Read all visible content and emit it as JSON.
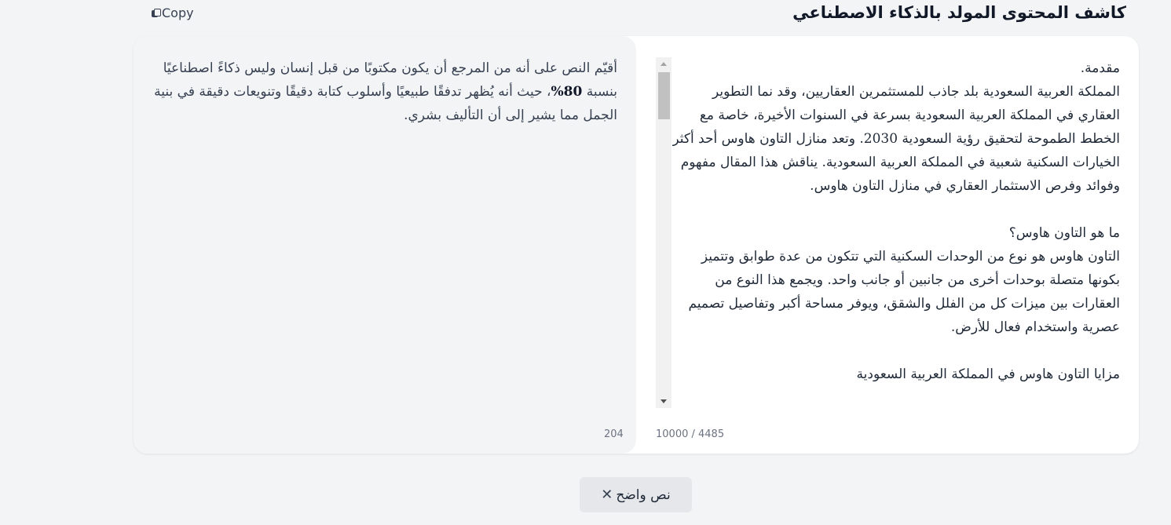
{
  "header": {
    "title": "كاشف المحتوى المولد بالذكاء الاصطناعي",
    "copy_label": "Copy",
    "copy_icon": "copy-icon"
  },
  "result": {
    "text_before": "أقيّم النص على أنه من المرجع أن يكون مكتوبًا من قبل إنسان وليس ذكاءً اصطناعيًا بنسبة ",
    "percentage": "80%",
    "text_after": "، حيث أنه يُظهر تدفقًا طبيعيًا وأسلوب كتابة دقيقًا وتنويعات دقيقة في بنية الجمل مما يشير إلى أن التأليف بشري.",
    "word_count": "204"
  },
  "input": {
    "text": "مقدمة.\nالمملكة العربية السعودية بلد جاذب للمستثمرين العقاريين، وقد نما التطوير العقاري في المملكة العربية السعودية بسرعة في السنوات الأخيرة، خاصة مع الخطط الطموحة لتحقيق رؤية السعودية 2030. وتعد منازل التاون هاوس أحد أكثر الخيارات السكنية شعبية في المملكة العربية السعودية. يناقش هذا المقال مفهوم وفوائد وفرص الاستثمار العقاري في منازل التاون هاوس.\n\nما هو التاون هاوس؟\nالتاون هاوس هو نوع من الوحدات السكنية التي تتكون من عدة طوابق وتتميز بكونها متصلة بوحدات أخرى من جانبين أو جانب واحد. ويجمع هذا النوع من العقارات بين ميزات كل من الفلل والشقق، ويوفر مساحة أكبر وتفاصيل تصميم عصرية واستخدام فعال للأرض.\n\nمزايا التاون هاوس في المملكة العربية السعودية",
    "char_count": "10000 / 4485"
  },
  "actions": {
    "clear_label": "نص واضح",
    "clear_icon": "close-icon"
  },
  "colors": {
    "page_bg": "#f3f4f6",
    "card_bg": "#ffffff",
    "result_bg": "#f3f4f6",
    "button_bg": "#e5e7eb"
  }
}
